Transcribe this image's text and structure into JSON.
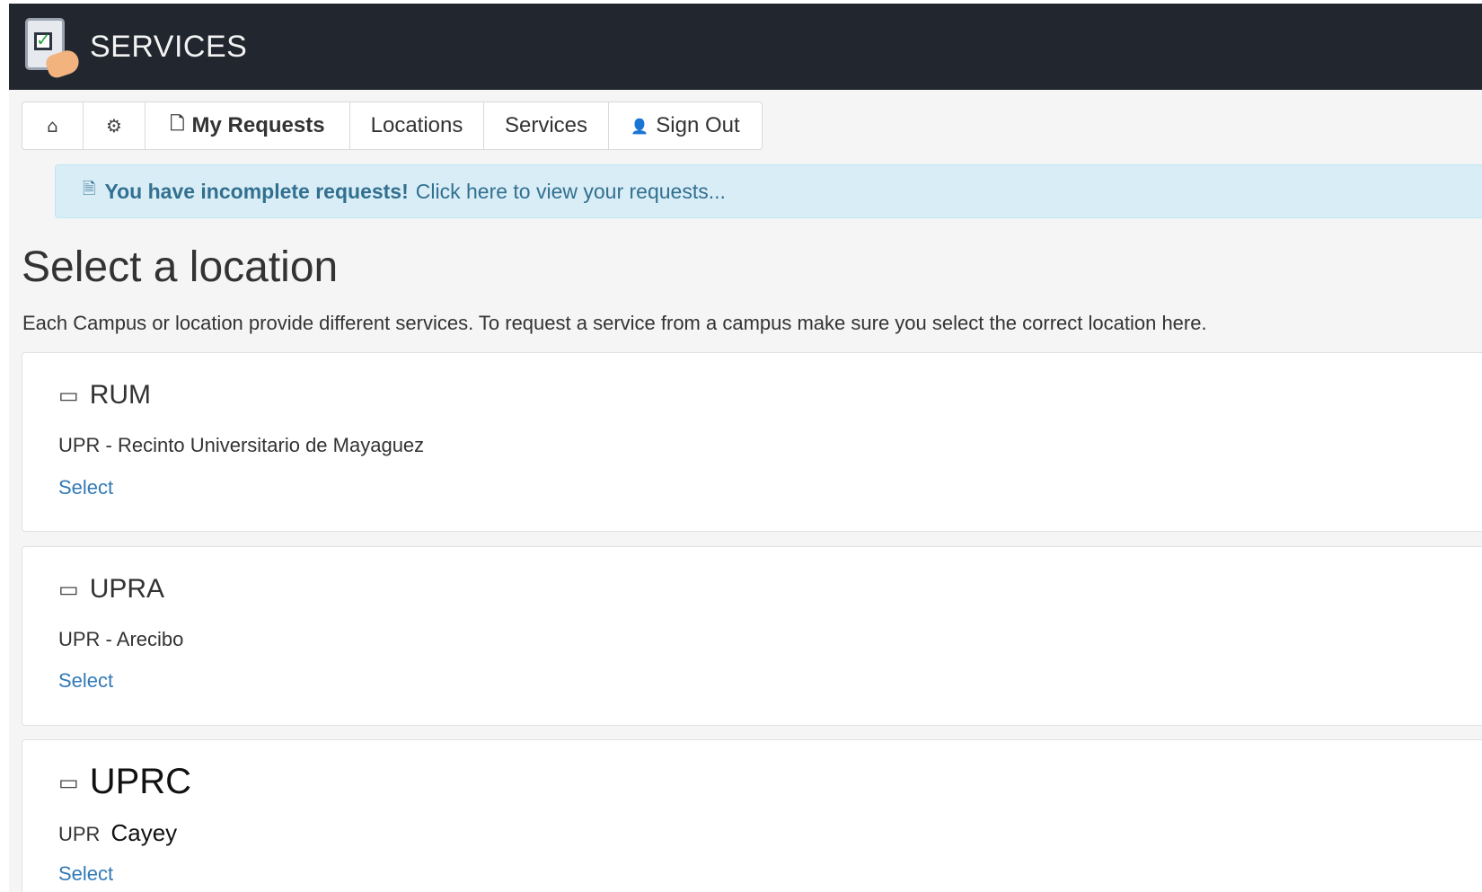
{
  "header": {
    "app_title": "SERVICES",
    "logo_icon": "clipboard-hand-icon"
  },
  "nav": {
    "items": [
      {
        "icon": "home-icon",
        "glyph": "⌂",
        "label": ""
      },
      {
        "icon": "gear-icon",
        "glyph": "⚙",
        "label": ""
      },
      {
        "icon": "file-icon",
        "glyph": "🗋",
        "label": "My Requests"
      },
      {
        "icon": "",
        "glyph": "",
        "label": "Locations"
      },
      {
        "icon": "",
        "glyph": "",
        "label": "Services"
      },
      {
        "icon": "user-icon",
        "glyph": "👤",
        "label": "Sign Out"
      }
    ]
  },
  "alert": {
    "strong": "You have incomplete requests!",
    "text": "Click here to view your requests...",
    "color": "#d9edf7"
  },
  "main": {
    "title": "Select a location",
    "description": "Each Campus or location provide different services. To request a service from a campus make sure you select the correct location here."
  },
  "locations": [
    {
      "code": "RUM",
      "name": "UPR - Recinto Universitario de Mayaguez",
      "action": "Select"
    },
    {
      "code": "UPRA",
      "name": "UPR - Arecibo",
      "action": "Select"
    },
    {
      "code": "UPRC",
      "name_prefix": "UPR",
      "name_suffix": "Cayey",
      "action": "Select"
    }
  ],
  "colors": {
    "header_bg": "#22272f",
    "link": "#337ab7",
    "alert_text": "#31708f"
  }
}
